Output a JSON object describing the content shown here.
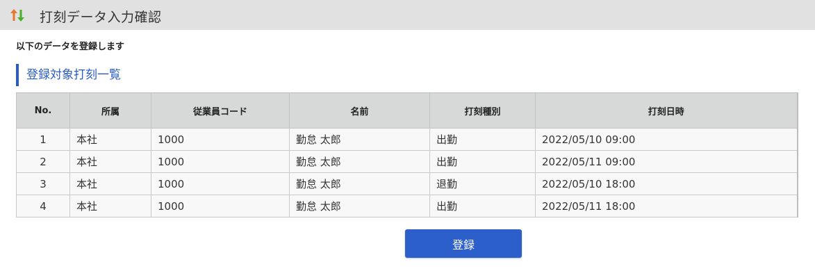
{
  "header": {
    "title": "打刻データ入力確認",
    "icon": "up-down-arrows-icon"
  },
  "intro_text": "以下のデータを登録します",
  "section_title": "登録対象打刻一覧",
  "table": {
    "columns": [
      "No.",
      "所属",
      "従業員コード",
      "名前",
      "打刻種別",
      "打刻日時"
    ],
    "rows": [
      {
        "no": "1",
        "dept": "本社",
        "code": "1000",
        "name": "勤怠 太郎",
        "type": "出勤",
        "datetime": "2022/05/10 09:00"
      },
      {
        "no": "2",
        "dept": "本社",
        "code": "1000",
        "name": "勤怠 太郎",
        "type": "出勤",
        "datetime": "2022/05/11 09:00"
      },
      {
        "no": "3",
        "dept": "本社",
        "code": "1000",
        "name": "勤怠 太郎",
        "type": "退勤",
        "datetime": "2022/05/10 18:00"
      },
      {
        "no": "4",
        "dept": "本社",
        "code": "1000",
        "name": "勤怠 太郎",
        "type": "出勤",
        "datetime": "2022/05/11 18:00"
      }
    ]
  },
  "register_button_label": "登録",
  "colors": {
    "accent": "#2d5fca",
    "header_bg": "#e1e1e1",
    "arrow_up": "#e8772e",
    "arrow_down": "#4caf2a"
  }
}
